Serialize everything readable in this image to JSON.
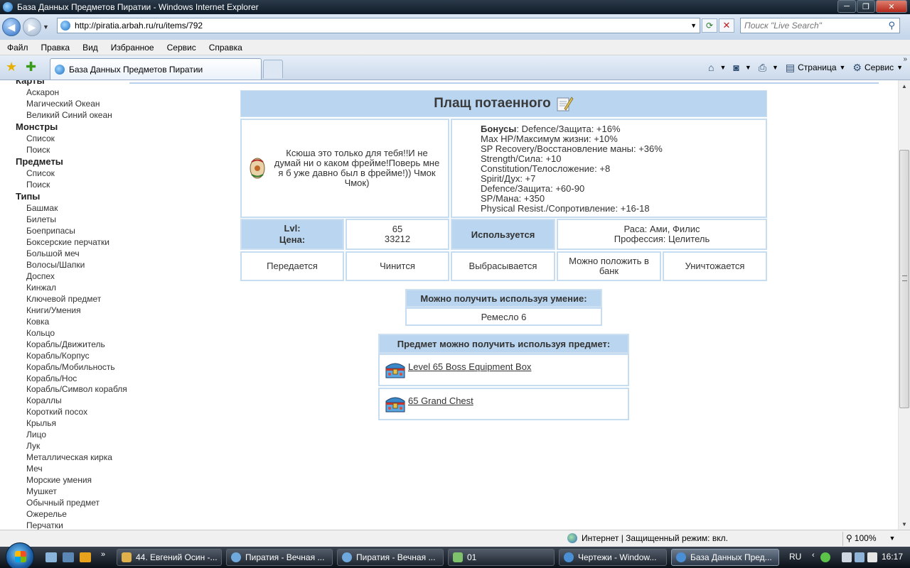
{
  "window": {
    "title": "База Данных Предметов Пиратии - Windows Internet Explorer",
    "buttons": [
      "─",
      "❐",
      "✕"
    ]
  },
  "address": {
    "url": "http://piratia.arbah.ru/ru/items/792",
    "search_placeholder": "Поиск \"Live Search\""
  },
  "menu": [
    "Файл",
    "Правка",
    "Вид",
    "Избранное",
    "Сервис",
    "Справка"
  ],
  "tab": {
    "label": "База Данных Предметов Пиратии"
  },
  "commandbar": {
    "page": "Страница",
    "tools": "Сервис"
  },
  "sidebar": {
    "maps_title": "Карты",
    "maps": [
      "Аскарон",
      "Магический Океан",
      "Великий Синий океан"
    ],
    "monsters_title": "Монстры",
    "monsters": [
      "Список",
      "Поиск"
    ],
    "items_title": "Предметы",
    "items": [
      "Список",
      "Поиск"
    ],
    "types_title": "Типы",
    "types": [
      "Башмак",
      "Билеты",
      "Боеприпасы",
      "Боксерские перчатки",
      "Большой меч",
      "Волосы/Шапки",
      "Доспех",
      "Кинжал",
      "Ключевой предмет",
      "Книги/Умения",
      "Ковка",
      "Кольцо",
      "Корабль/Движитель",
      "Корабль/Корпус",
      "Корабль/Мобильность",
      "Корабль/Нос",
      "Корабль/Символ корабля",
      "Кораллы",
      "Короткий посох",
      "Крылья",
      "Лицо",
      "Лук",
      "Металлическая кирка",
      "Меч",
      "Морские умения",
      "Мушкет",
      "Обычный предмет",
      "Ожерелье",
      "Перчатки"
    ]
  },
  "item": {
    "name": "Плащ потаенного",
    "description": "Ксюша это только для тебя!!И не думай ни о каком фрейме!Поверь мне я б уже давно был в фрейме!)) Чмок Чмок)",
    "bonus_label": "Бонусы",
    "bonus_first": ": Defence/Защита: +16%",
    "bonuses": [
      "Max HP/Максимум жизни: +10%",
      "SP Recovery/Восстановление маны: +36%",
      "Strength/Сила: +10",
      "Constitution/Телосложение: +8",
      "Spirit/Дух: +7",
      "Defence/Защита: +60-90",
      "SP/Мана: +350",
      "Physical Resist./Сопротивление: +16-18"
    ],
    "lvl_label": "Lvl:",
    "price_label": "Цена:",
    "lvl": "65",
    "price": "33212",
    "used_label": "Используется",
    "race": "Раса: Ами, Филис",
    "profession": "Профессия: Целитель",
    "flags": [
      "Передается",
      "Чинится",
      "Выбрасывается",
      "Можно положить в банк",
      "Уничтожается"
    ],
    "skill_head": "Можно получить используя умение:",
    "skill": "Ремесло 6",
    "from_head": "Предмет можно получить используя предмет:",
    "sources": [
      "Level 65 Boss Equipment Box",
      "65 Grand Chest"
    ]
  },
  "status": {
    "zone": "Интернет | Защищенный режим: вкл.",
    "zoom": "100%"
  },
  "taskbar": {
    "tasks": [
      "44. Евгений Осин -...",
      "Пиратия - Вечная ...",
      "Пиратия - Вечная ...",
      "01",
      "Чертежи - Window...",
      "База Данных Пред..."
    ],
    "lang": "RU",
    "time": "16:17"
  }
}
